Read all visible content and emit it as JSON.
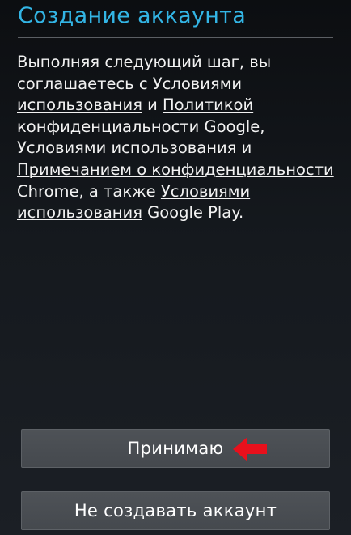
{
  "header": {
    "title": "Создание аккаунта"
  },
  "terms": {
    "t1": "Выполняя следующий шаг, вы",
    "t2": "соглашаетесь с ",
    "l1": "Условиями",
    "l2": "использования",
    "t3": " и ",
    "l3": "Политикой",
    "l4": "конфиденциальности",
    "t4": " Google,",
    "l5": "Условиями использования",
    "t5": " и",
    "l6": "Примечанием о конфиденциальности",
    "t6": "Chrome, а также ",
    "l7": "Условиями",
    "l8": "использования",
    "t7": " Google Play."
  },
  "actions": {
    "accept_label": "Принимаю",
    "decline_label": "Не создавать аккаунт"
  },
  "annotation": {
    "arrow_icon": "red-arrow-left-icon",
    "arrow_color": "#e8101c"
  },
  "colors": {
    "title": "#33b5e5",
    "button": "#4a4e53"
  }
}
